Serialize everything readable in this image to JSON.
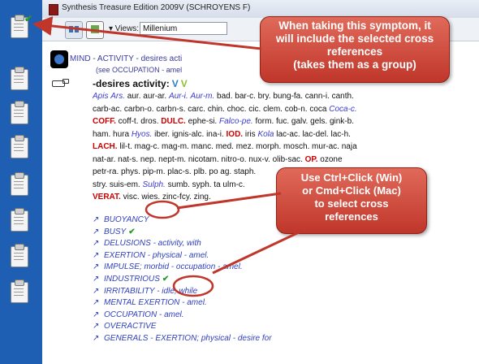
{
  "window": {
    "title": "Synthesis Treasure Edition 2009V (SCHROYENS F)"
  },
  "toolbar": {
    "views_label": "▾ Views:",
    "views_value": "Millenium"
  },
  "path": {
    "mind": "MIND",
    "rest": "- ACTIVITY - desires acti",
    "subpath": "(see OCCUPATION - amel"
  },
  "rubric": {
    "dash": "-",
    "name": "desires activity:",
    "v1": "V",
    "v2": "V"
  },
  "remedies": [
    [
      [
        "blue",
        "Apis"
      ],
      [
        "n",
        " "
      ],
      [
        "blue",
        "Ars."
      ],
      [
        "n",
        " aur. aur-ar. "
      ],
      [
        "blue",
        "Aur-i."
      ],
      [
        "n",
        " "
      ],
      [
        "blue",
        "Aur-m."
      ],
      [
        "n",
        " bad. bar-c. bry. bung-fa. cann-i. canth."
      ]
    ],
    [
      [
        "n",
        "carb-ac. carbn-o. carbn-s. carc. chin. choc. cic. clem. cob-n. coca "
      ],
      [
        "blue",
        "Coca-c."
      ]
    ],
    [
      [
        "red",
        "COFF."
      ],
      [
        "n",
        " coff-t. dros. "
      ],
      [
        "red",
        "DULC."
      ],
      [
        "n",
        " ephe-si. "
      ],
      [
        "blue",
        "Falco-pe."
      ],
      [
        "n",
        " form. fuc. galv. gels. gink-b."
      ]
    ],
    [
      [
        "n",
        "ham. hura "
      ],
      [
        "blue",
        "Hyos."
      ],
      [
        "n",
        " iber. ignis-alc. ina-i. "
      ],
      [
        "red",
        "IOD."
      ],
      [
        "n",
        " iris "
      ],
      [
        "blue",
        "Kola"
      ],
      [
        "n",
        " lac-ac. lac-del. lac-h."
      ]
    ],
    [
      [
        "red",
        "LACH."
      ],
      [
        "n",
        " lil-t. mag-c. mag-m. manc. med. mez. morph. mosch. mur-ac. naja"
      ]
    ],
    [
      [
        "n",
        "nat-ar. nat-s. nep. nept-m. nicotam. nitro-o. nux-v. olib-sac. "
      ],
      [
        "red",
        "OP."
      ],
      [
        "n",
        " ozone"
      ]
    ],
    [
      [
        "n",
        "petr-ra. phys. pip-m. plac-s. plb. po                                 ag. staph."
      ]
    ],
    [
      [
        "n",
        "stry. suis-em. "
      ],
      [
        "blue",
        "Sulph."
      ],
      [
        "n",
        " sumb. syph. ta                                      ulm-c."
      ]
    ],
    [
      [
        "red",
        "VERAT."
      ],
      [
        "n",
        " visc. wies. zinc-fcy. zing."
      ]
    ]
  ],
  "cross_references": [
    {
      "text": "BUOYANCY",
      "checked": false
    },
    {
      "text": "BUSY",
      "checked": true
    },
    {
      "text": "DELUSIONS - activity, with",
      "checked": false
    },
    {
      "text": "EXERTION - physical - amel.",
      "checked": false
    },
    {
      "text": "IMPULSE; morbid - occupation - amel.",
      "checked": false
    },
    {
      "text": "INDUSTRIOUS",
      "checked": true
    },
    {
      "text": "IRRITABILITY - idle, while",
      "checked": false
    },
    {
      "text": "MENTAL EXERTION - amel.",
      "checked": false
    },
    {
      "text": "OCCUPATION - amel.",
      "checked": false
    },
    {
      "text": "OVERACTIVE",
      "checked": false
    },
    {
      "text": "GENERALS - EXERTION; physical - desire for",
      "checked": false
    }
  ],
  "callouts": {
    "top": [
      "When taking this symptom, it",
      "will include the selected cross",
      "references",
      "(takes them as a group)"
    ],
    "bottom": [
      "Use Ctrl+Click (Win)",
      "or Cmd+Click (Mac)",
      "to select cross",
      "references"
    ]
  },
  "icons": {
    "ref_arrow": "↗",
    "check": "✔"
  },
  "colors": {
    "sidebar": "#1f5fb3",
    "callout": "#c0362a",
    "link_blue": "#2f3fbf",
    "remedy_red": "#c00000"
  }
}
